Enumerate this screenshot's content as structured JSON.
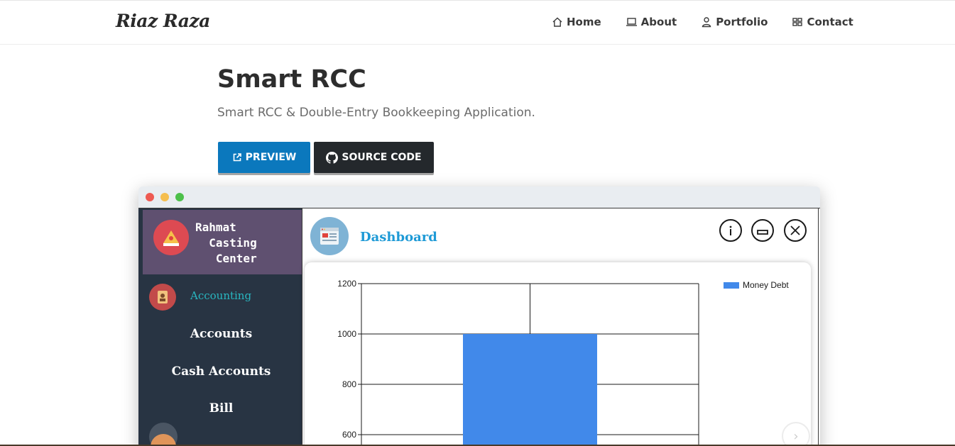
{
  "header": {
    "brand": "Riaz Raza",
    "nav": [
      {
        "label": "Home",
        "icon": "home-icon"
      },
      {
        "label": "About",
        "icon": "laptop-icon"
      },
      {
        "label": "Portfolio",
        "icon": "user-icon"
      },
      {
        "label": "Contact",
        "icon": "grid-icon"
      }
    ]
  },
  "hero": {
    "title": "Smart RCC",
    "subtitle": "Smart RCC & Double-Entry Bookkeeping Application.",
    "preview_label": "PREVIEW",
    "source_label": "SOURCE CODE"
  },
  "app": {
    "company_name": "Rahmat\n  Casting\n   Center",
    "sidebar": {
      "section": "Accounting",
      "links": [
        "Accounts",
        "Cash Accounts",
        "Bill"
      ]
    },
    "dashboard_title": "Dashboard"
  },
  "colors": {
    "preview_button": "#0b78bd",
    "source_button": "#24282c",
    "sidebar_bg": "#283443",
    "company_bg": "#5f5070",
    "accent_teal": "#29b6c0",
    "dashboard_title": "#1e9ad6",
    "bar": "#4189ea",
    "mac_red": "#ee5a52",
    "mac_yellow": "#f5be4f",
    "mac_green": "#4cc04a"
  },
  "chart_data": {
    "type": "bar",
    "categories": [
      ""
    ],
    "series": [
      {
        "name": "Money Debt",
        "values": [
          1000
        ]
      }
    ],
    "ylim_visible": [
      600,
      1200
    ],
    "yticks": [
      600,
      800,
      1000,
      1200
    ],
    "legend": "top-right",
    "grid": true
  }
}
